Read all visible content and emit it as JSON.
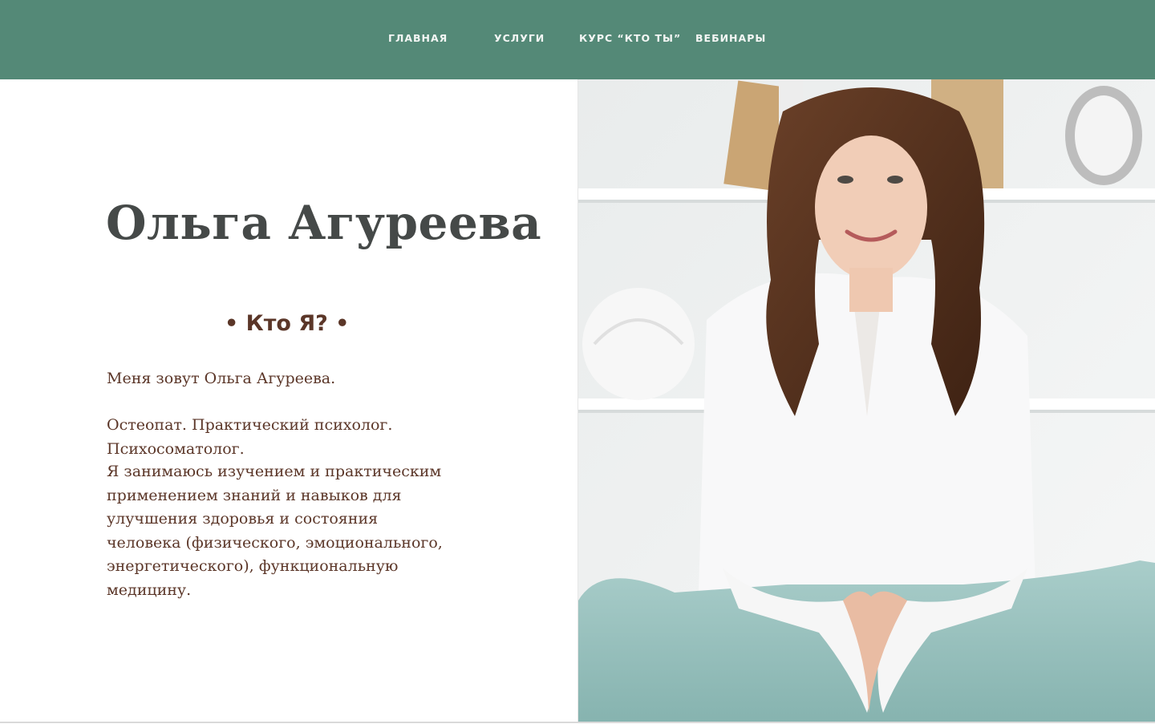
{
  "nav": {
    "items": [
      {
        "label": "ГЛАВНАЯ"
      },
      {
        "label": "УСЛУГИ"
      },
      {
        "label": "КУРС “КТО ТЫ”"
      },
      {
        "label": "ВЕБИНАРЫ"
      }
    ]
  },
  "hero": {
    "name": "Ольга Агуреева",
    "section_heading": "• Кто Я? •",
    "paragraphs": [
      "Меня зовут Ольга Агуреева.",
      "Остеопат. Практический психолог. Психосоматолог.",
      "Я занимаюсь изучением и практическим применением знаний и навыков для улучшения здоровья и состояния человека (физического, эмоционального, энергетического), функциональную медицину."
    ]
  },
  "colors": {
    "nav_bg": "#548977",
    "title_text": "#454948",
    "body_text": "#5b3628"
  },
  "photo": {
    "subject": "portrait-photo"
  }
}
